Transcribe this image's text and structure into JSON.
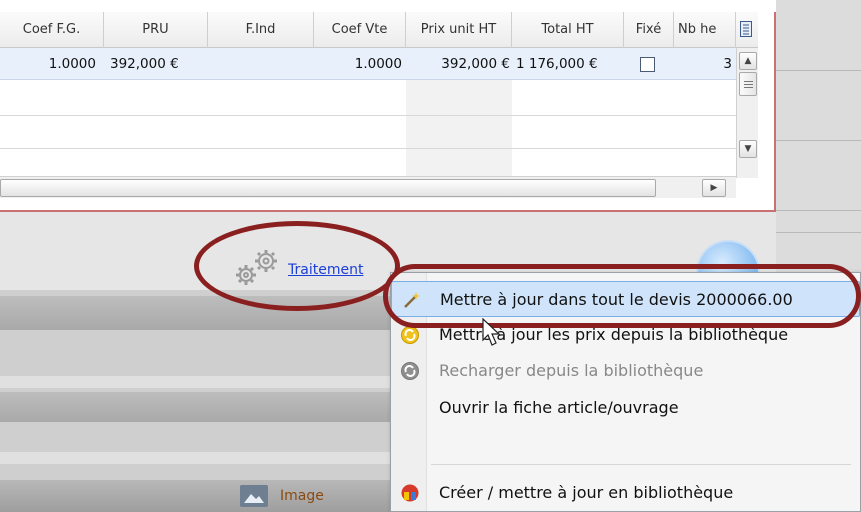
{
  "grid": {
    "columns": [
      "Coef F.G.",
      "PRU",
      "F.Ind",
      "Coef Vte",
      "Prix unit HT",
      "Total HT",
      "Fixé",
      "Nb he"
    ],
    "row": {
      "coef_fg": "1.0000",
      "pru": "392,000 €",
      "find": "",
      "coef_vte": "1.0000",
      "prix_unit_ht": "392,000 €",
      "total_ht": "1 176,000 €",
      "nb_he": "3"
    }
  },
  "toolbar": {
    "traitement_label": "Traitement",
    "image_label": "Image"
  },
  "context_menu": {
    "items": [
      {
        "label": "Mettre à jour dans tout le devis 2000066.00",
        "icon": "magic-wand-icon",
        "highlighted": true,
        "disabled": false
      },
      {
        "label": "Mettre à jour les prix depuis la bibliothèque",
        "icon": "refresh-yellow-icon",
        "highlighted": false,
        "disabled": false
      },
      {
        "label": "Recharger depuis la bibliothèque",
        "icon": "reload-gray-icon",
        "highlighted": false,
        "disabled": true
      },
      {
        "label": "Ouvrir la fiche article/ouvrage",
        "icon": "",
        "highlighted": false,
        "disabled": false
      },
      {
        "label": "Créer / mettre à jour en bibliothèque",
        "icon": "library-icon",
        "highlighted": false,
        "disabled": false
      }
    ]
  },
  "colors": {
    "annotation": "#8a1f1f",
    "link": "#1a3fd6",
    "selection": "#e8f0fb",
    "menu_highlight": "#cfe4fb"
  }
}
